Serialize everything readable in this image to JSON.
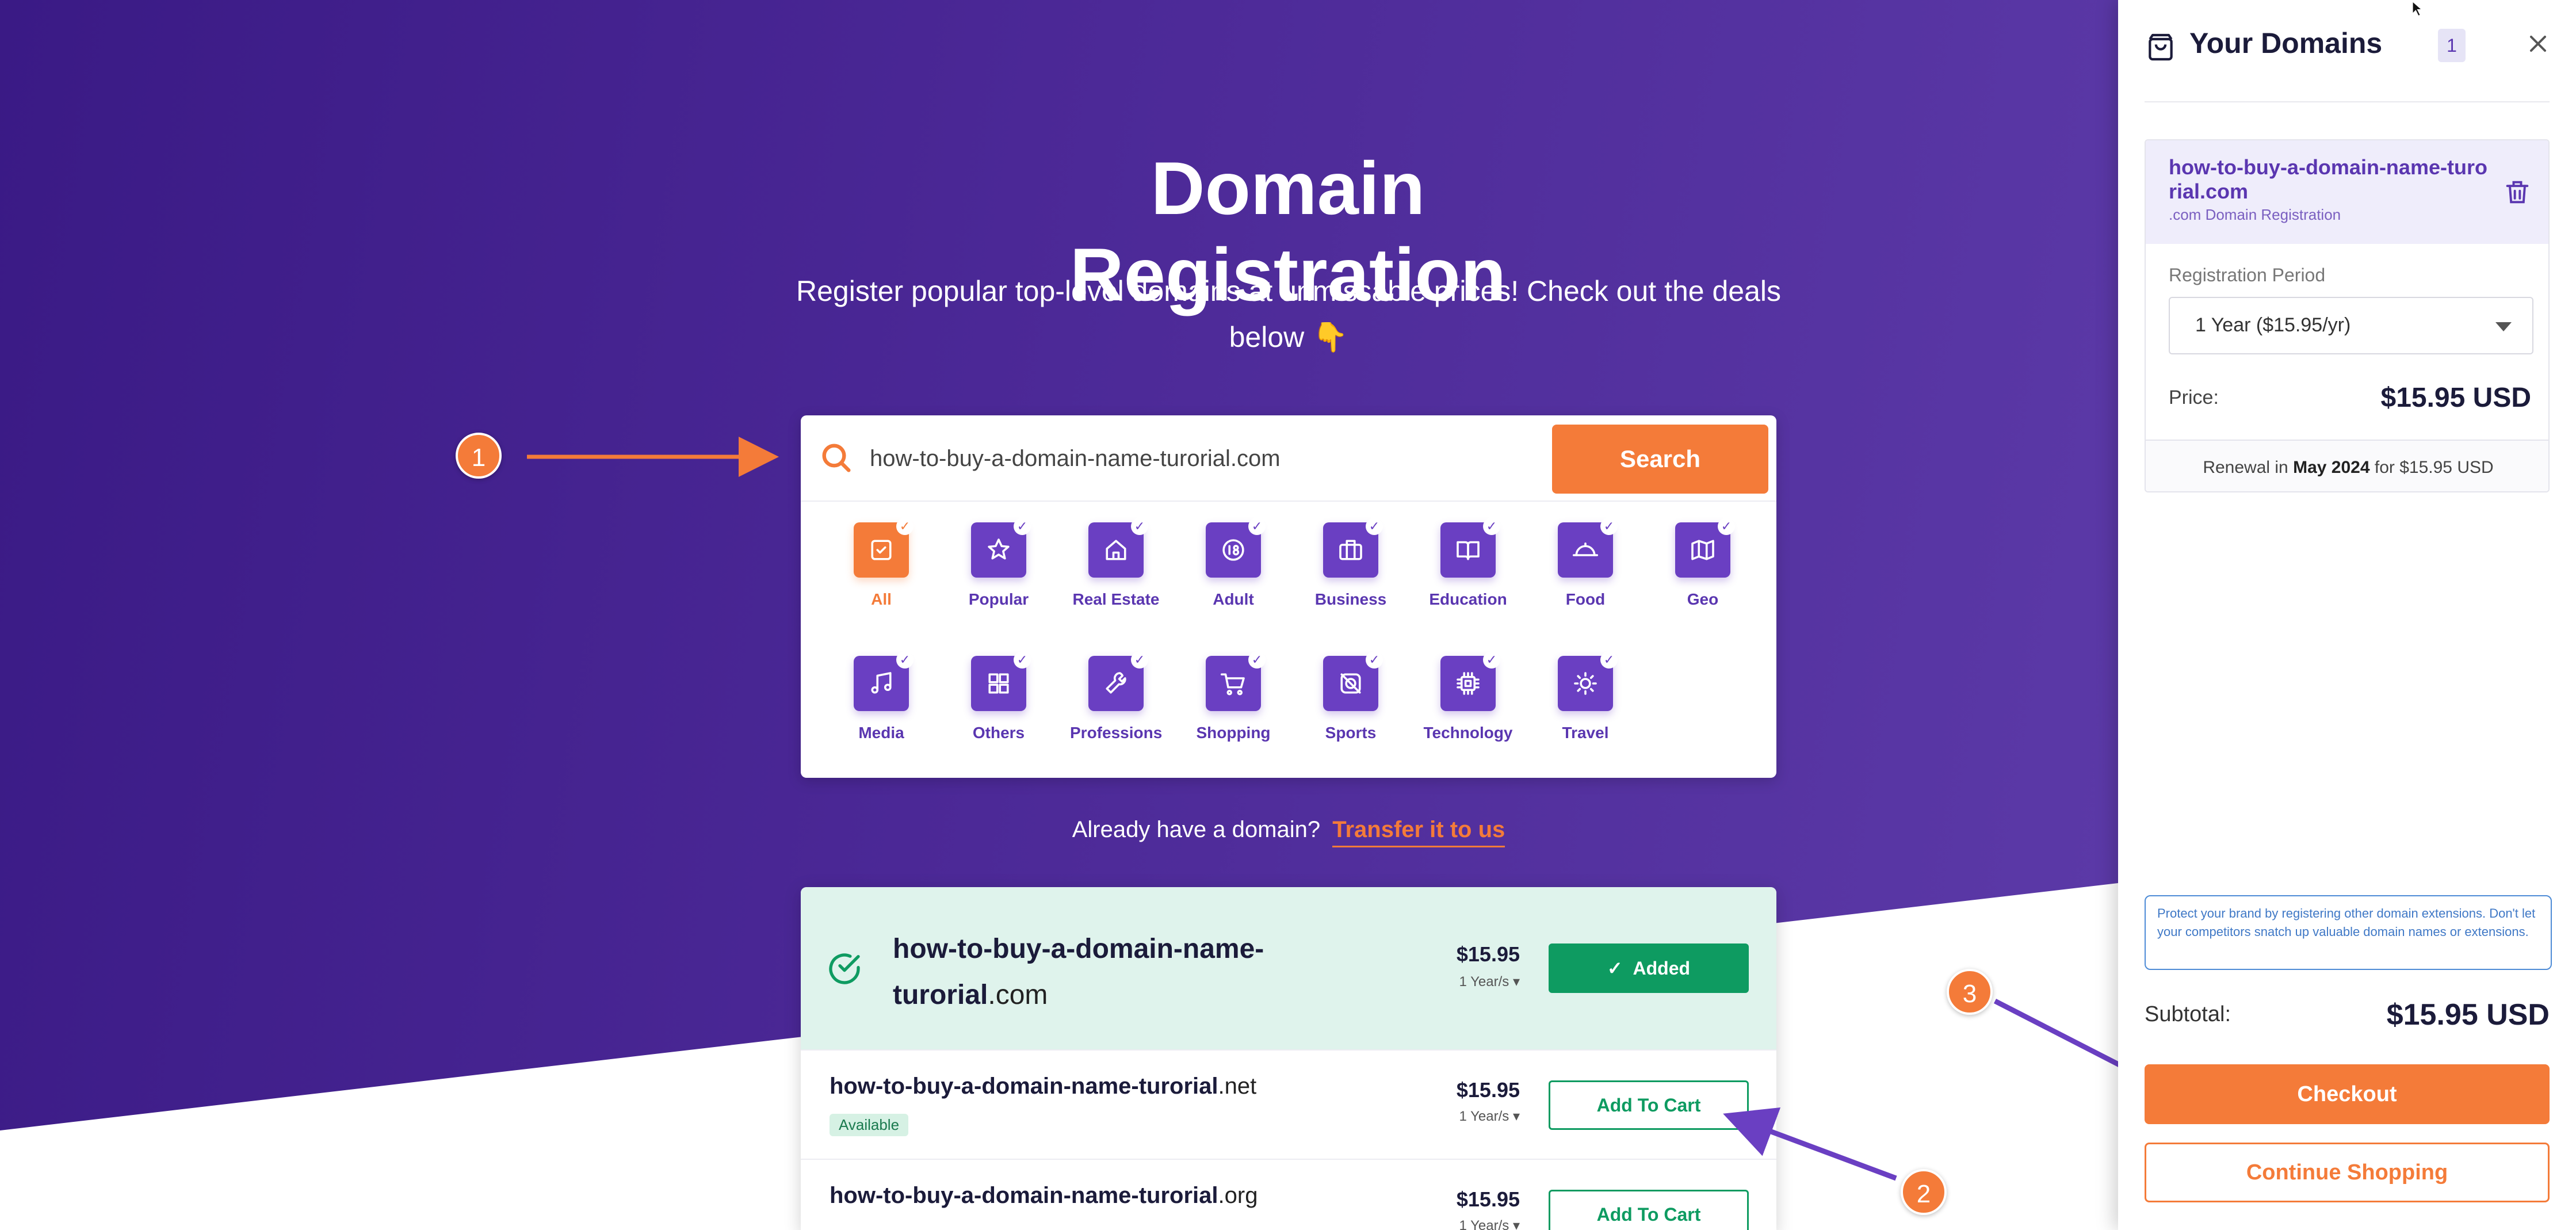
{
  "hero": {
    "title": "Domain Registration",
    "subtitle": "Register popular top-level domains at unmissable prices! Check out the deals below 👇"
  },
  "search": {
    "value": "how-to-buy-a-domain-name-turorial.com",
    "button_label": "Search"
  },
  "categories": [
    {
      "label": "All",
      "icon": "checkbox-icon",
      "active": true
    },
    {
      "label": "Popular",
      "icon": "star-icon"
    },
    {
      "label": "Real Estate",
      "icon": "house-icon"
    },
    {
      "label": "Adult",
      "icon": "18-icon"
    },
    {
      "label": "Business",
      "icon": "briefcase-icon"
    },
    {
      "label": "Education",
      "icon": "book-icon"
    },
    {
      "label": "Food",
      "icon": "cloche-icon"
    },
    {
      "label": "Geo",
      "icon": "map-icon"
    },
    {
      "label": "Media",
      "icon": "music-icon"
    },
    {
      "label": "Others",
      "icon": "grid-icon"
    },
    {
      "label": "Professions",
      "icon": "wrench-icon"
    },
    {
      "label": "Shopping",
      "icon": "cart-icon"
    },
    {
      "label": "Sports",
      "icon": "ball-icon"
    },
    {
      "label": "Technology",
      "icon": "chip-icon"
    },
    {
      "label": "Travel",
      "icon": "sun-icon"
    }
  ],
  "transfer": {
    "prompt": "Already have a domain?",
    "link": "Transfer it to us"
  },
  "results": [
    {
      "name": "how-to-buy-a-domain-name-turorial",
      "tld": ".com",
      "price": "$15.95",
      "period": "1 Year/s",
      "button": "Added",
      "status": ""
    },
    {
      "name": "how-to-buy-a-domain-name-turorial",
      "tld": ".net",
      "price": "$15.95",
      "period": "1 Year/s",
      "button": "Add To Cart",
      "status": "Available"
    },
    {
      "name": "how-to-buy-a-domain-name-turorial",
      "tld": ".org",
      "price": "$15.95",
      "period": "1 Year/s",
      "button": "Add To Cart",
      "status": ""
    }
  ],
  "annotations": [
    "1",
    "2",
    "3"
  ],
  "sidebar": {
    "title": "Your Domains",
    "count": "1",
    "item": {
      "domain": "how-to-buy-a-domain-name-turorial.com",
      "subtitle": ".com Domain Registration",
      "period_label": "Registration Period",
      "period_value": "1 Year ($15.95/yr)",
      "price_label": "Price:",
      "price": "$15.95 USD",
      "renewal_prefix": "Renewal in",
      "renewal_date": "May 2024",
      "renewal_suffix": "for $15.95 USD"
    },
    "note": "Protect your brand by registering other domain extensions. Don't let your competitors snatch up valuable domain names or extensions.",
    "subtotal_label": "Subtotal:",
    "subtotal": "$15.95 USD",
    "checkout": "Checkout",
    "continue": "Continue Shopping"
  },
  "colors": {
    "accent": "#f47b39",
    "brand": "#5a36b0",
    "success": "#0e9b61"
  }
}
